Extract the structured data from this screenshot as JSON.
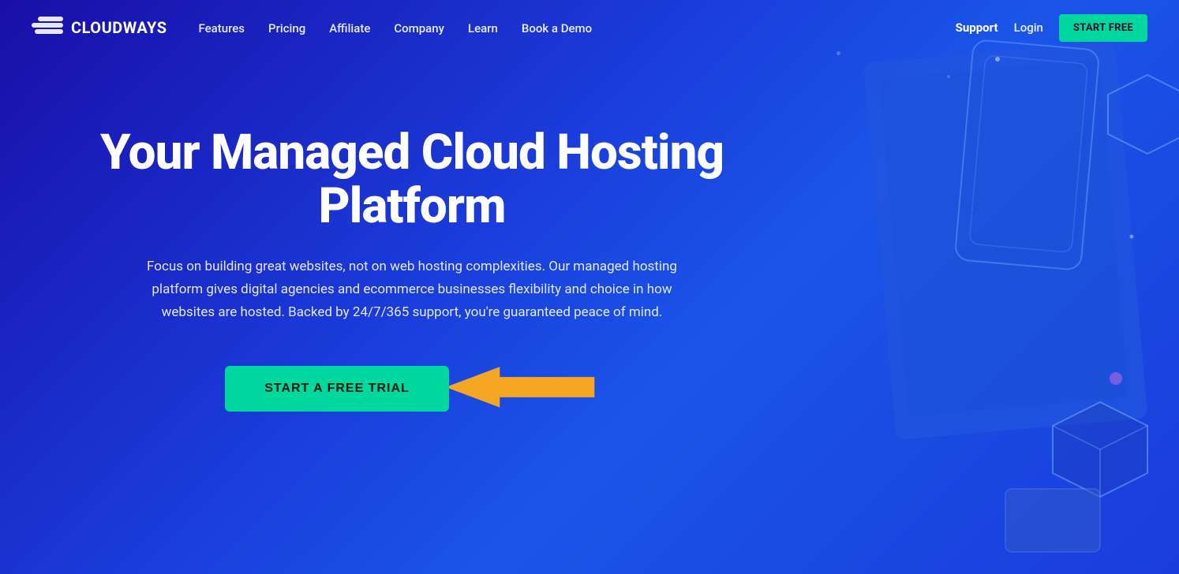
{
  "logo": {
    "text": "CLOUDWAYS"
  },
  "nav": {
    "links": [
      {
        "label": "Features",
        "name": "features"
      },
      {
        "label": "Pricing",
        "name": "pricing"
      },
      {
        "label": "Affiliate",
        "name": "affiliate"
      },
      {
        "label": "Company",
        "name": "company"
      },
      {
        "label": "Learn",
        "name": "learn"
      },
      {
        "label": "Book a Demo",
        "name": "book-a-demo"
      }
    ],
    "support_label": "Support",
    "login_label": "Login",
    "start_free_label": "START FREE"
  },
  "hero": {
    "title": "Your Managed Cloud Hosting Platform",
    "subtitle": "Focus on building great websites, not on web hosting complexities. Our managed hosting platform gives digital agencies and ecommerce businesses flexibility and choice in how websites are hosted. Backed by 24/7/365 support, you're guaranteed peace of mind.",
    "cta_label": "START A FREE TRIAL"
  },
  "colors": {
    "cta_bg": "#00d8a0",
    "nav_bg": "transparent",
    "page_bg_start": "#1a0ea8",
    "page_bg_end": "#1a55e8"
  }
}
